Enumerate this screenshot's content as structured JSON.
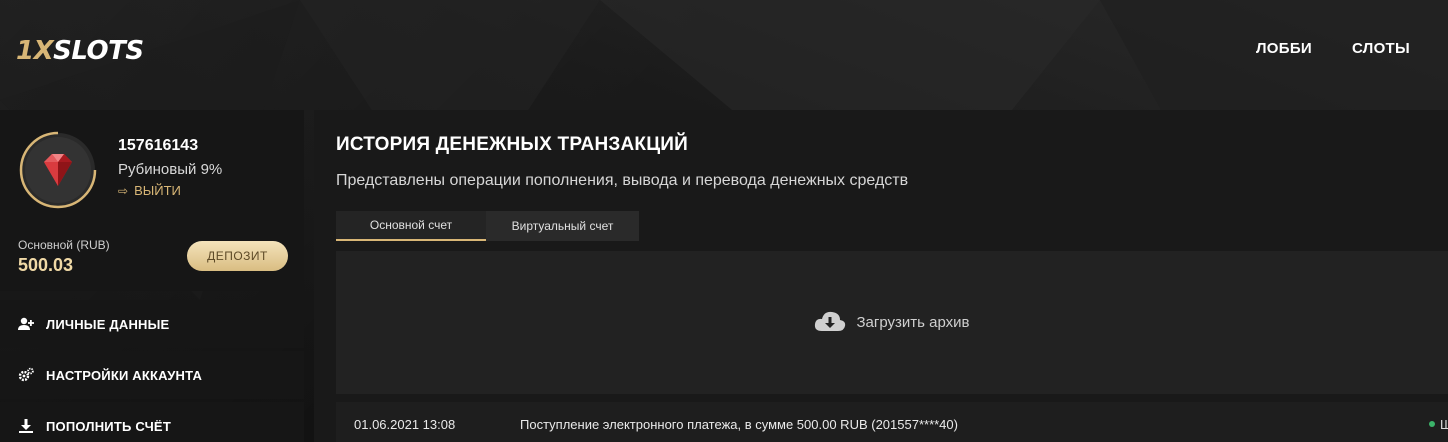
{
  "header": {
    "logo_part1": "1X",
    "logo_part2": "SLOTS",
    "nav": [
      "ЛОББИ",
      "СЛОТЫ"
    ]
  },
  "profile": {
    "user_id": "157616143",
    "level": "Рубиновый 9%",
    "logout_label": "ВЫЙТИ",
    "balance_label": "Основной (RUB)",
    "balance_value": "500.03",
    "deposit_label": "ДЕПОЗИТ",
    "avatar_icon": "ruby-gem-icon",
    "accent_color": "#d8b676"
  },
  "menu": [
    {
      "label": "ЛИЧНЫЕ ДАННЫЕ",
      "icon": "user-plus-icon"
    },
    {
      "label": "НАСТРОЙКИ АККАУНТА",
      "icon": "gears-icon"
    },
    {
      "label": "ПОПОЛНИТЬ СЧЁТ",
      "icon": "download-icon"
    }
  ],
  "main": {
    "title": "ИСТОРИЯ ДЕНЕЖНЫХ ТРАНЗАКЦИЙ",
    "subtitle": "Представлены операции пополнения, вывода и перевода денежных средств",
    "tabs": [
      "Основной счет",
      "Виртуальный счет"
    ],
    "archive_label": "Загрузить архив",
    "transactions": [
      {
        "date": "01.06.2021 13:08",
        "description": "Поступление электронного платежа, в сумме 500.00 RUB (201557****40)",
        "status_text": "Ш",
        "status_color": "#3bb36a"
      }
    ]
  }
}
